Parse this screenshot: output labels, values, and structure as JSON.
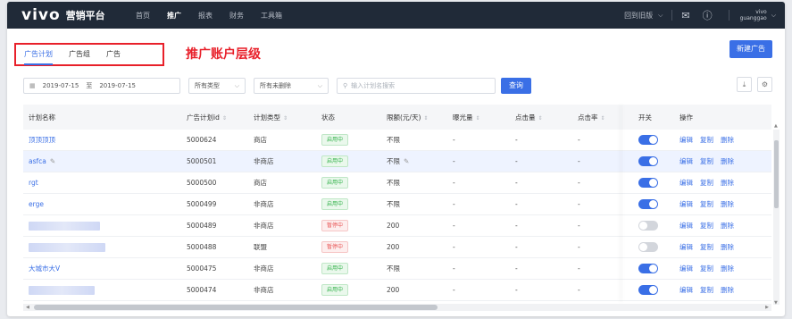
{
  "topbar": {
    "logo": "vivo",
    "platform_name": "营销平台",
    "nav": [
      "首页",
      "推广",
      "报表",
      "财务",
      "工具箱"
    ],
    "active_nav": "推广",
    "old_version": "回到旧版",
    "user_name": "vivo",
    "user_account": "guanggao"
  },
  "tabs": [
    "广告计划",
    "广告组",
    "广告"
  ],
  "annotation": "推广账户层级",
  "new_button": "新建广告",
  "filters": {
    "date_start": "2019-07-15",
    "date_sep": "至",
    "date_end": "2019-07-15",
    "type_select": "所有类型",
    "delete_select": "所有未删除",
    "search_placeholder": "输入计划名搜索",
    "query_button": "查询"
  },
  "columns": [
    "计划名称",
    "广告计划id",
    "计划类型",
    "状态",
    "限额(元/天)",
    "曝光量",
    "点击量",
    "点击率",
    "开关",
    "操作"
  ],
  "rows": [
    {
      "name": "顶顶顶顶",
      "id": "5000624",
      "type": "商店",
      "status": "启用中",
      "limit": "不限",
      "imp": "-",
      "clk": "-",
      "ctr": "-",
      "on": true
    },
    {
      "name": "asfca",
      "id": "5000501",
      "type": "非商店",
      "status": "启用中",
      "limit": "不限",
      "imp": "-",
      "clk": "-",
      "ctr": "-",
      "on": true
    },
    {
      "name": "rgt",
      "id": "5000500",
      "type": "商店",
      "status": "启用中",
      "limit": "不限",
      "imp": "-",
      "clk": "-",
      "ctr": "-",
      "on": true
    },
    {
      "name": "erge",
      "id": "5000499",
      "type": "非商店",
      "status": "启用中",
      "limit": "不限",
      "imp": "-",
      "clk": "-",
      "ctr": "-",
      "on": true
    },
    {
      "name": "",
      "id": "5000489",
      "type": "非商店",
      "status": "暂停中",
      "limit": "200",
      "imp": "-",
      "clk": "-",
      "ctr": "-",
      "on": false
    },
    {
      "name": "",
      "id": "5000488",
      "type": "联盟",
      "status": "暂停中",
      "limit": "200",
      "imp": "-",
      "clk": "-",
      "ctr": "-",
      "on": false
    },
    {
      "name": "大城市大V",
      "id": "5000475",
      "type": "非商店",
      "status": "启用中",
      "limit": "不限",
      "imp": "-",
      "clk": "-",
      "ctr": "-",
      "on": true
    },
    {
      "name": "",
      "id": "5000474",
      "type": "非商店",
      "status": "启用中",
      "limit": "200",
      "imp": "-",
      "clk": "-",
      "ctr": "-",
      "on": true
    }
  ],
  "ops": [
    "编辑",
    "复制",
    "删除"
  ]
}
